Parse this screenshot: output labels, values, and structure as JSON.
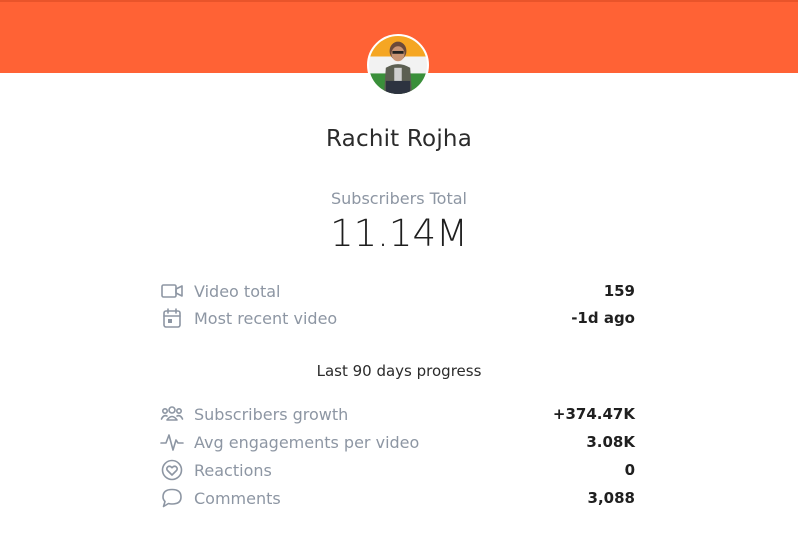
{
  "colors": {
    "header": "#ff6235",
    "label": "#8d96a3",
    "value": "#1f1f1f"
  },
  "channel": {
    "name": "Rachit Rojha"
  },
  "subscribers": {
    "label": "Subscribers Total",
    "value": "11.14M"
  },
  "overview": [
    {
      "icon": "video-camera-icon",
      "label": "Video total",
      "value": "159"
    },
    {
      "icon": "calendar-icon",
      "label": "Most recent video",
      "value": "-1d ago"
    }
  ],
  "progress": {
    "title": "Last 90 days progress",
    "stats": [
      {
        "icon": "users-icon",
        "label": "Subscribers growth",
        "value": "+374.47K"
      },
      {
        "icon": "pulse-icon",
        "label": "Avg engagements per video",
        "value": "3.08K"
      },
      {
        "icon": "heart-circle-icon",
        "label": "Reactions",
        "value": "0"
      },
      {
        "icon": "speech-bubble-icon",
        "label": "Comments",
        "value": "3,088"
      }
    ]
  }
}
